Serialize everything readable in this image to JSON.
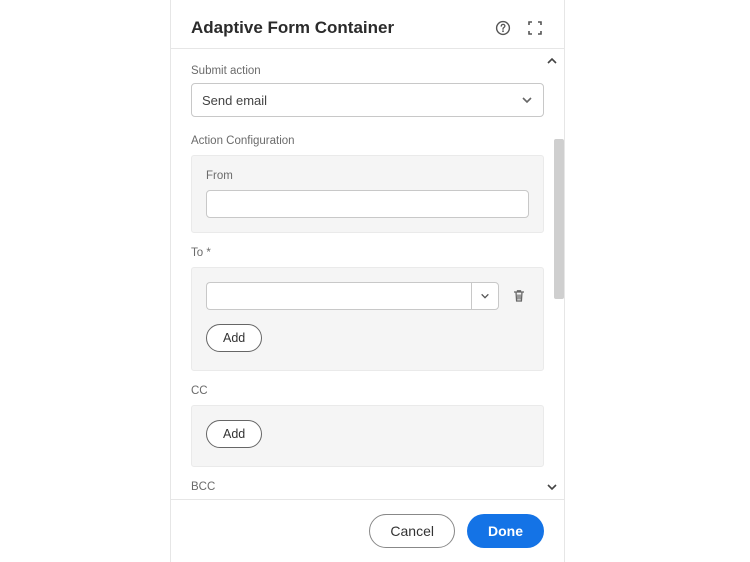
{
  "header": {
    "title": "Adaptive Form Container"
  },
  "submit": {
    "label": "Submit action",
    "selected": "Send email"
  },
  "config": {
    "label": "Action Configuration",
    "from_label": "From",
    "from_value": "",
    "to_label": "To *",
    "to_value": "",
    "cc_label": "CC",
    "bcc_label": "BCC",
    "add_label": "Add"
  },
  "footer": {
    "cancel": "Cancel",
    "done": "Done"
  }
}
